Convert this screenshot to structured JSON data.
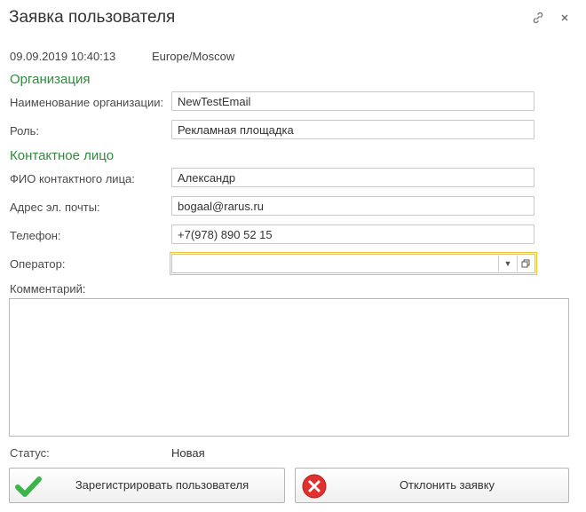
{
  "window": {
    "title": "Заявка пользователя",
    "link_icon": "link-icon",
    "close_icon": "close-icon"
  },
  "meta": {
    "datetime": "09.09.2019 10:40:13",
    "timezone": "Europe/Moscow"
  },
  "organization": {
    "section_title": "Организация",
    "name_label": "Наименование организации:",
    "name_value": "NewTestEmail",
    "role_label": "Роль:",
    "role_value": "Рекламная площадка"
  },
  "contact": {
    "section_title": "Контактное лицо",
    "fio_label": "ФИО контактного лица:",
    "fio_value": "Александр",
    "email_label": "Адрес эл. почты:",
    "email_value": "bogaal@rarus.ru",
    "phone_label": "Телефон:",
    "phone_value": "+7(978) 890 52 15",
    "operator_label": "Оператор:",
    "operator_value": ""
  },
  "comment": {
    "label": "Комментарий:",
    "value": ""
  },
  "status": {
    "label": "Статус:",
    "value": "Новая"
  },
  "actions": {
    "register_label": "Зарегистрировать пользователя",
    "reject_label": "Отклонить заявку"
  },
  "colors": {
    "section": "#2e8b3d",
    "focus": "#f1c232",
    "ok": "#3bb54a",
    "cancel": "#e03030"
  }
}
